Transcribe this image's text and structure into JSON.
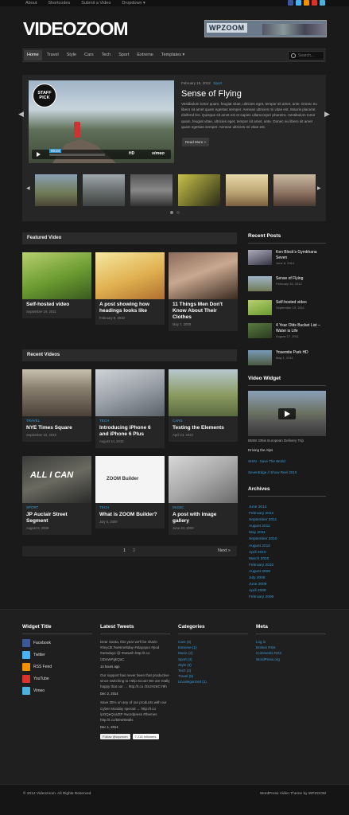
{
  "top_menu": [
    "About",
    "Shortcodes",
    "Submit a Video",
    "Dropdown ▾"
  ],
  "logo": "VIDEOZOOM",
  "banner": "WPZOOM",
  "nav": [
    "Home",
    "Travel",
    "Style",
    "Cars",
    "Tech",
    "Sport",
    "Extreme",
    "Templates ▾"
  ],
  "search_placeholder": "Search...",
  "slide": {
    "date": "February 15, 2012",
    "category": "Sport",
    "title": "Sense of Flying",
    "excerpt": "Vestibulum tortor quam, feugiat vitae, ultricies eget, tempor sit amet, ante. Donec eu libero sit amet quam egestas semper. Aenean ultricies mi vitae est. Mauris placerat eleifend leo. Quisque sit amet est et sapien ullamcorper pharetra. Vestibulum tortor quam, feugiat vitae, ultricies eget, tempor sit amet, ante. Donec eu libero sit amet quam egestas semper. Aenean ultricies mi vitae est.",
    "read_more": "Read More »",
    "badge": "STAFF PICK",
    "time": "00:24",
    "hd": "HD",
    "vimeo": "vimeo"
  },
  "featured_heading": "Featured Video",
  "featured": [
    {
      "title": "Self-hosted video",
      "date": "September 19, 2011"
    },
    {
      "title": "A post showing how headings looks like",
      "date": "February 8, 2010"
    },
    {
      "title": "11 Things Men Don't Know About Their Clothes",
      "date": "May 7, 2009"
    }
  ],
  "recent_heading": "Recent Videos",
  "recent": [
    {
      "cat": "TRAVEL",
      "title": "NYE Times Square",
      "date": "September 22, 2010"
    },
    {
      "cat": "TECH",
      "title": "Introducing iPhone 6 and iPhone 6 Plus",
      "date": "August 14, 2010"
    },
    {
      "cat": "CARS",
      "title": "Testing the Elements",
      "date": "April 23, 2010"
    },
    {
      "cat": "SPORT",
      "title": "JP Auclair Street Segment",
      "date": "August 6, 2009"
    },
    {
      "cat": "TECH",
      "title": "What is ZOOM Builder?",
      "date": "July 6, 2009"
    },
    {
      "cat": "MUSIC",
      "title": "A post with image gallery",
      "date": "June 23, 2009"
    }
  ],
  "zoom_builder": "ZOOM Builder",
  "all_i_can": "ALL I CAN",
  "pager": {
    "p1": "1",
    "p2": "2",
    "next": "Next »"
  },
  "sidebar": {
    "recent_posts_heading": "Recent Posts",
    "recent_posts": [
      {
        "title": "Ken Block's Gymkhana Seven",
        "date": "June 8, 2014"
      },
      {
        "title": "Sense of Flying",
        "date": "February 15, 2012"
      },
      {
        "title": "Self-hosted video",
        "date": "September 19, 2011"
      },
      {
        "title": "4 Year Olds Bucket List – Water is Life",
        "date": "August 17, 2011"
      },
      {
        "title": "Yosemite Park HD",
        "date": "May 1, 2011"
      }
    ],
    "video_widget_heading": "Video Widget",
    "video_widget_caption": "BMW 335is European Delivery Trip",
    "video_links": [
      "Driving the Alps",
      "SHIN - Save The World",
      "SevenEdge // Show Reel 2010"
    ],
    "archives_heading": "Archives",
    "archives": [
      "June 2014",
      "February 2012",
      "September 2011",
      "August 2011",
      "May 2011",
      "September 2010",
      "August 2010",
      "April 2010",
      "March 2010",
      "February 2010",
      "August 2009",
      "July 2009",
      "June 2009",
      "April 2009",
      "February 2009"
    ]
  },
  "footer": {
    "widget_title": "Widget Title",
    "social": [
      "Facebook",
      "Twitter",
      "RSS Feed",
      "YouTube",
      "Vimeo"
    ],
    "tweets_heading": "Latest Tweets",
    "tweets": [
      {
        "text": "Dear Santa, this year we'll be sharin #tinycbt #wetmeltday #stayopro #pod #artsdaye @ #tutweh http://t.co /3DsWPgkQaC",
        "date": "14 hours ago"
      },
      {
        "text": "Our support has never been that productive since switching to Help Scout! We are really happy that our … http://t.co /2SJHz6CY9h",
        "date": "Dec 2, 2014"
      },
      {
        "text": "Save 35% on any of our products with our Cyber Monday special → http://t.co /pOQeQcaZtP #wordpress #themes http://t.co/bEW5Mdls",
        "date": "Dec 1, 2014"
      }
    ],
    "follow": "Follow @wpzoom",
    "followers": "7,218 followers",
    "categories_heading": "Categories",
    "categories": [
      "Cars (4)",
      "Extreme (1)",
      "Music (2)",
      "Sport (4)",
      "Style (3)",
      "Tech (3)",
      "Travel (5)",
      "Uncategorized (1)"
    ],
    "meta_heading": "Meta",
    "meta": [
      "Log in",
      "Entries RSS",
      "Comments RSS",
      "WordPress.org"
    ]
  },
  "copyright": "© 2014 Videozoom. All Rights Reserved.",
  "credit": "WordPress Video Theme by WPZOOM"
}
